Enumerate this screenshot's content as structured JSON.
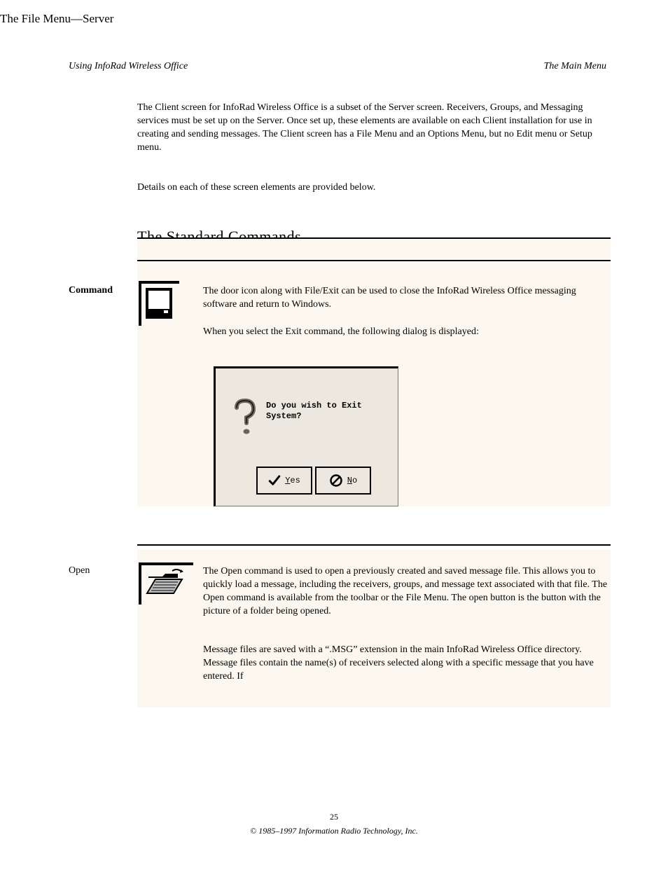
{
  "header": {
    "left": "Using InfoRad Wireless Office",
    "right": "The Main Menu"
  },
  "intro": {
    "paragraph": "The Client screen for InfoRad Wireless Office is a subset of the Server screen. Receivers, Groups, and Messaging services must be set up on the Server. Once set up, these elements are available on each Client installation for use in creating and sending messages. The Client screen has a File Menu and an Options Menu, but no Edit menu or Setup menu.",
    "screen_details": "Details on each of these screen elements are provided below."
  },
  "section": {
    "heading": "The Standard Commands",
    "col_label": "Command"
  },
  "exit": {
    "line1": "The door icon along with File/Exit can be used to close the InfoRad Wireless Office messaging software and return to Windows.",
    "line2": "When you select the Exit command, the following dialog is displayed:"
  },
  "dialog": {
    "message": "Do you wish to Exit System?",
    "yes_u": "Y",
    "yes_rest": "es",
    "no_u": "N",
    "no_rest": "o"
  },
  "file": {
    "heading": "The File Menu—Server",
    "row_label": "Open",
    "para1": "The Open command is used to open a previously created and saved message file. This allows you to quickly load a message, including the receivers, groups, and message text associated with that file. The Open command is available from the toolbar or the File Menu. The open button is the button with the picture of a folder being opened.",
    "para2": "Message files are saved with a “.MSG” extension in the main InfoRad Wireless Office directory. Message files contain the name(s) of receivers selected along with a specific message that you have entered. If"
  },
  "footer": {
    "page": "25",
    "copyright": "© 1985–1997 Information Radio Technology, Inc."
  }
}
